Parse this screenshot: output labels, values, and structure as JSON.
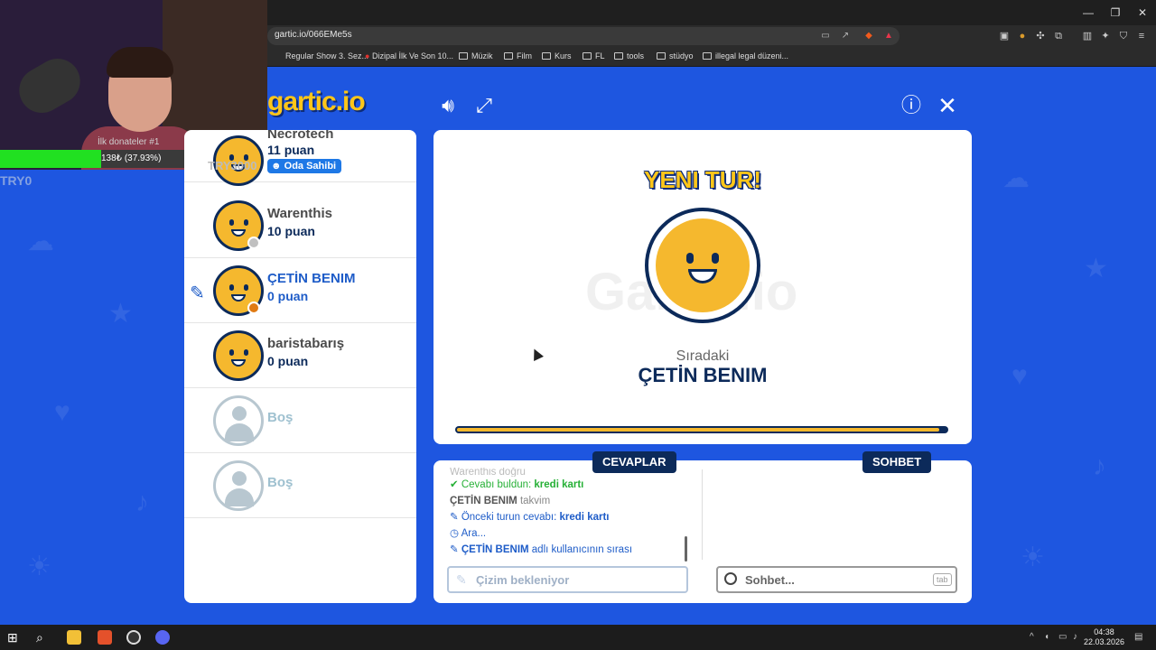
{
  "browser": {
    "url": "gartic.io/066EMe5s",
    "bookmarks": [
      "Regular Show 3. Sez...",
      "Dizipal İlk Ve Son 10...",
      "Müzik",
      "Film",
      "Kurs",
      "FL",
      "tools",
      "stüdyo",
      "illegal legal düzeni..."
    ]
  },
  "stream": {
    "donor_label": "İlk donateler #1",
    "goal_text": "138₺ (37.93%)",
    "goal_fraction": 0.3793,
    "tag": "TRY0"
  },
  "game": {
    "logo": "gartic.io"
  },
  "players": [
    {
      "name": "Necrotech",
      "score": "11 puan",
      "badge": "Oda Sahibi",
      "overlay_tag": "TRY3000"
    },
    {
      "name": "Warenthis",
      "score": "10 puan",
      "status_color": "#c0c0c0"
    },
    {
      "name": "ÇETİN BENIM",
      "score": "0 puan",
      "status_color": "#e07a12"
    },
    {
      "name": "baristabarış",
      "score": "0 puan"
    },
    {
      "name": "Boş"
    },
    {
      "name": "Boş"
    }
  ],
  "board": {
    "headline": "YENI TUR!",
    "watermark": "Gartic.io",
    "next_label": "Sıradaki",
    "next_player": "ÇETİN BENIM",
    "progress_fraction": 0.985
  },
  "answers": {
    "tab_label": "CEVAPLAR",
    "lines": {
      "faded": "Warenthis doğru",
      "found_prefix": "Cevabı buldun: ",
      "found_word": "kredi kartı",
      "guess_name": "ÇETİN BENIM",
      "guess_word": " takvim",
      "prev_prefix": "Önceki turun cevabı: ",
      "prev_word": "kredi kartı",
      "waiting": "Ara...",
      "turn_name": "ÇETİN BENIM",
      "turn_suffix": " adlı kullanıcının sırası"
    },
    "input_placeholder": "Çizim bekleniyor"
  },
  "chat": {
    "tab_label": "SOHBET",
    "input_placeholder": "Sohbet...",
    "shortcut": "tab"
  },
  "taskbar": {
    "time": "04:38",
    "date": "22.03.2026"
  },
  "colors": {
    "background": "#1e56e0",
    "navy": "#0c2a5a",
    "accent_blue": "#1e5cc8",
    "gold": "#f5b82e",
    "success_green": "#26b036"
  }
}
